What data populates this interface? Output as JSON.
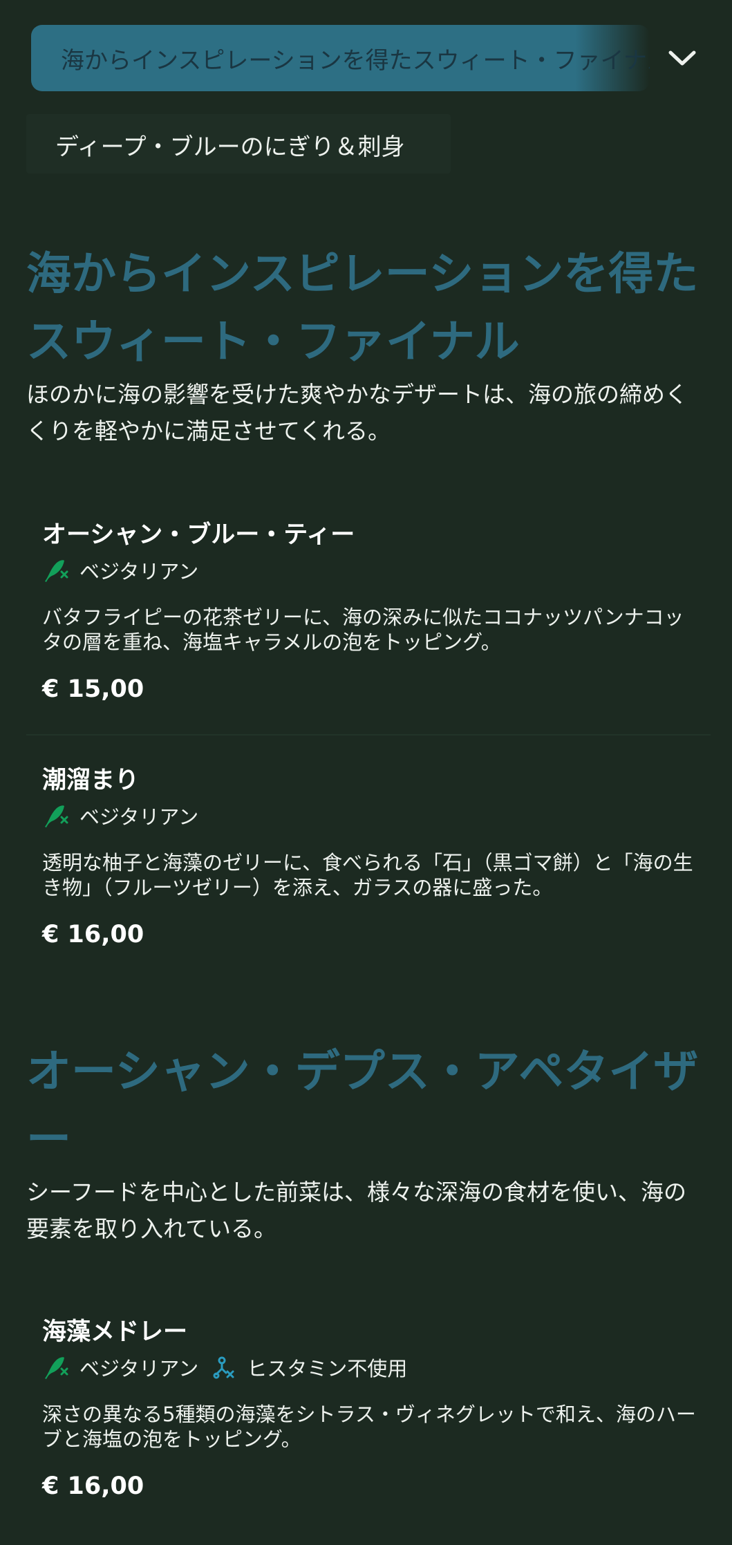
{
  "header": {
    "category_select_value": "海からインスピレーションを得たスウィート・ファイナル",
    "subcategory_tab": "ディープ・ブルーのにぎり＆刺身"
  },
  "sections": [
    {
      "title": "海からインスピレーションを得たスウィート・ファイナル",
      "description": "ほのかに海の影響を受けた爽やかなデザートは、海の旅の締めくくりを軽やかに満足させてくれる。",
      "items": [
        {
          "name": "オーシャン・ブルー・ティー",
          "tags": [
            {
              "icon": "vegetarian-leaf-icon",
              "label": "ベジタリアン"
            }
          ],
          "description": "バタフライピーの花茶ゼリーに、海の深みに似たココナッツパンナコッタの層を重ね、海塩キャラメルの泡をトッピング。",
          "price": "€ 15,00"
        },
        {
          "name": "潮溜まり",
          "tags": [
            {
              "icon": "vegetarian-leaf-icon",
              "label": "ベジタリアン"
            }
          ],
          "description": "透明な柚子と海藻のゼリーに、食べられる「石」（黒ゴマ餅）と「海の生き物」（フルーツゼリー）を添え、ガラスの器に盛った。",
          "price": "€ 16,00"
        }
      ]
    },
    {
      "title": "オーシャン・デプス・アペタイザー",
      "description": "シーフードを中心とした前菜は、様々な深海の食材を使い、海の要素を取り入れている。",
      "items": [
        {
          "name": "海藻メドレー",
          "tags": [
            {
              "icon": "vegetarian-leaf-icon",
              "label": "ベジタリアン"
            },
            {
              "icon": "histamine-free-icon",
              "label": "ヒスタミン不使用"
            }
          ],
          "description": "深さの異なる5種類の海藻をシトラス・ヴィネグレットで和え、海のハーブと海塩の泡をトッピング。",
          "price": "€ 16,00"
        }
      ]
    }
  ],
  "colors": {
    "background": "#1c2a21",
    "select_background": "#2d6f84",
    "section_title": "#2e6a7f",
    "vegetarian_icon": "#12a05a",
    "histamine_icon": "#2a9cc0"
  }
}
